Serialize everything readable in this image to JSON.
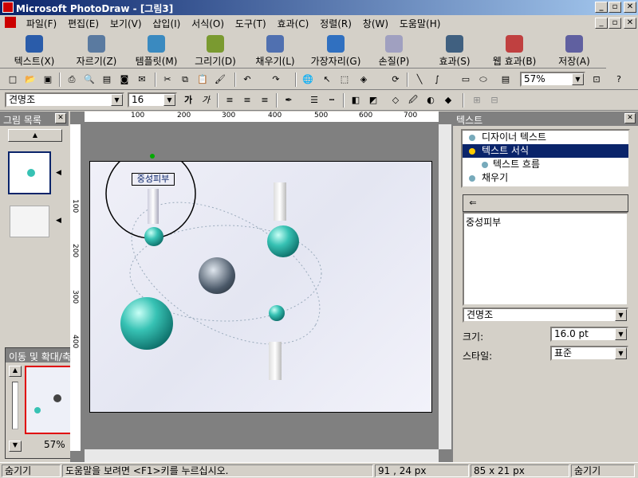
{
  "window": {
    "title": "Microsoft PhotoDraw - [그림3]"
  },
  "menu": [
    "파일(F)",
    "편집(E)",
    "보기(V)",
    "삽입(I)",
    "서식(O)",
    "도구(T)",
    "효과(C)",
    "정렬(R)",
    "창(W)",
    "도움말(H)"
  ],
  "bigbar": [
    {
      "label": "텍스트(X)",
      "icon": "text-a-icon",
      "color": "#2a5caa"
    },
    {
      "label": "자르기(Z)",
      "icon": "scissors-icon",
      "color": "#5a7aa0"
    },
    {
      "label": "템플릿(M)",
      "icon": "template-house-icon",
      "color": "#3a8ac0"
    },
    {
      "label": "그리기(D)",
      "icon": "pen-draw-icon",
      "color": "#7a9a30"
    },
    {
      "label": "채우기(L)",
      "icon": "paint-bucket-icon",
      "color": "#5070b0"
    },
    {
      "label": "가장자리(G)",
      "icon": "edge-icon",
      "color": "#3070c0"
    },
    {
      "label": "손질(P)",
      "icon": "touchup-icon",
      "color": "#a0a0c0"
    },
    {
      "label": "효과(S)",
      "icon": "effects-icon",
      "color": "#406080"
    },
    {
      "label": "웹 효과(B)",
      "icon": "web-effects-icon",
      "color": "#c04040"
    },
    {
      "label": "저장(A)",
      "icon": "save-icon",
      "color": "#6060a0"
    }
  ],
  "zoom_combo": "57%",
  "font_combo": "견명조",
  "size_combo": "16",
  "left_panel": {
    "title": "그림 목록"
  },
  "nav_panel": {
    "title": "이동 및 확대/축소",
    "zoom": "57%"
  },
  "right_panel": {
    "title": "텍스트",
    "list": [
      {
        "label": "디자이너 텍스트",
        "selected": false
      },
      {
        "label": "텍스트 서식",
        "selected": true
      },
      {
        "label": "텍스트 흐름",
        "selected": false
      },
      {
        "label": "채우기",
        "selected": false
      }
    ],
    "text_value": "중성피부",
    "font_combo": "견명조",
    "size_label": "크기:",
    "size_value": "16.0 pt",
    "style_label": "스타일:",
    "style_value": "표준"
  },
  "canvas": {
    "text_object": "중성피부"
  },
  "ruler": {
    "top": [
      "100",
      "200",
      "300",
      "400",
      "500",
      "600",
      "700"
    ],
    "left": [
      "100",
      "200",
      "300",
      "400"
    ]
  },
  "status": {
    "hide_left": "숨기기",
    "help": "도움말을 보려면 <F1>키를 누르십시오.",
    "pos": "91 , 24  px",
    "size": "85 x 21  px",
    "hide_right": "숨기기"
  }
}
